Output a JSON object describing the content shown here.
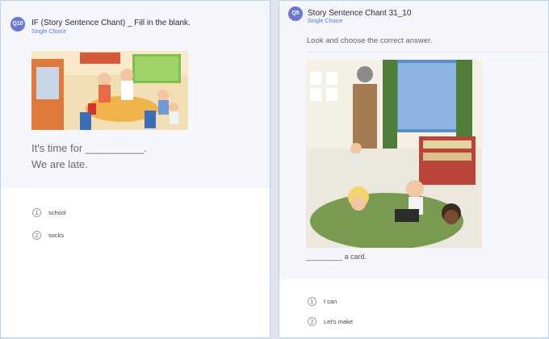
{
  "left_question": {
    "badge": "Q10",
    "title": "IF (Story Sentence Chant) _ Fill in the blank.",
    "type_label": "Single Choice",
    "sentence_line1": "It's time for __________.",
    "sentence_line2": "We are late.",
    "options": [
      {
        "num": "1",
        "text": "school"
      },
      {
        "num": "2",
        "text": "socks"
      }
    ]
  },
  "right_question": {
    "badge": "Q5",
    "title": "Story Sentence Chant 31_10",
    "type_label": "Single Choice",
    "instruction": "Look and choose the correct answer.",
    "blank_sentence": "_________ a card.",
    "options": [
      {
        "num": "1",
        "text": "I can"
      },
      {
        "num": "2",
        "text": "Let's make"
      }
    ]
  },
  "colors": {
    "badge": "#6a77d4",
    "type_label": "#5a78d6",
    "card_border": "#bcd3ee",
    "header_bg": "#f5f6fc"
  },
  "icons": [
    "kitchen-scene-illustration",
    "art-class-illustration"
  ]
}
